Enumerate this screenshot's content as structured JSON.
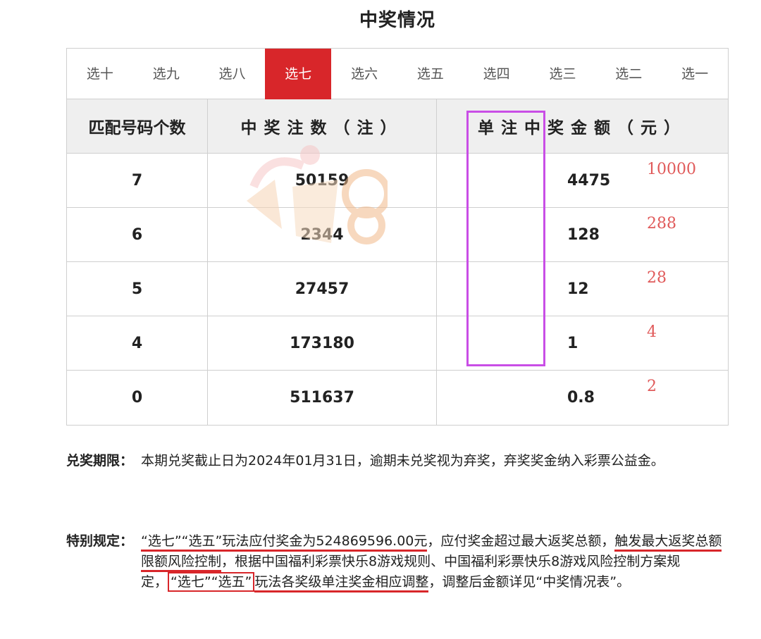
{
  "title": "中奖情况",
  "tabs": [
    {
      "label": "选十",
      "active": false
    },
    {
      "label": "选九",
      "active": false
    },
    {
      "label": "选八",
      "active": false
    },
    {
      "label": "选七",
      "active": true
    },
    {
      "label": "选六",
      "active": false
    },
    {
      "label": "选五",
      "active": false
    },
    {
      "label": "选四",
      "active": false
    },
    {
      "label": "选三",
      "active": false
    },
    {
      "label": "选二",
      "active": false
    },
    {
      "label": "选一",
      "active": false
    }
  ],
  "table": {
    "headers": [
      "匹配号码个数",
      "中奖注数（注）",
      "单注中奖金额（元）"
    ],
    "rows": [
      {
        "match": "7",
        "count": "50159",
        "amount": "4475",
        "annotation": "10000"
      },
      {
        "match": "6",
        "count": "2344",
        "amount": "128",
        "annotation": "288"
      },
      {
        "match": "5",
        "count": "27457",
        "amount": "12",
        "annotation": "28"
      },
      {
        "match": "4",
        "count": "173180",
        "amount": "1",
        "annotation": "4"
      },
      {
        "match": "0",
        "count": "511637",
        "amount": "0.8",
        "annotation": "2"
      }
    ]
  },
  "notes": {
    "deadline_label": "兑奖期限：",
    "deadline_text": "本期兑奖截止日为2024年01月31日，逾期未兑奖视为弃奖，弃奖奖金纳入彩票公益金。",
    "special_label": "特别规定：",
    "special_parts": {
      "p1": "“选七”“选五”玩法应付奖金为524869596.00元",
      "p2": "，应付奖金超过最大返奖总额，",
      "p3": "触发最大返奖总额限额风险控制",
      "p4": "，根据中国福利彩票快乐8游戏规则、中国福利彩票快乐8游戏风险控制方案规定，",
      "p5": "“选七”“选五”",
      "p6": "玩法各奖级单注奖金相应",
      "p7": "调整",
      "p8": "，调整后金额详见“中奖情况表”。"
    }
  },
  "colors": {
    "accent": "#d8262a",
    "highlight_box": "#c94ee6",
    "annotation": "#e05a5a"
  }
}
